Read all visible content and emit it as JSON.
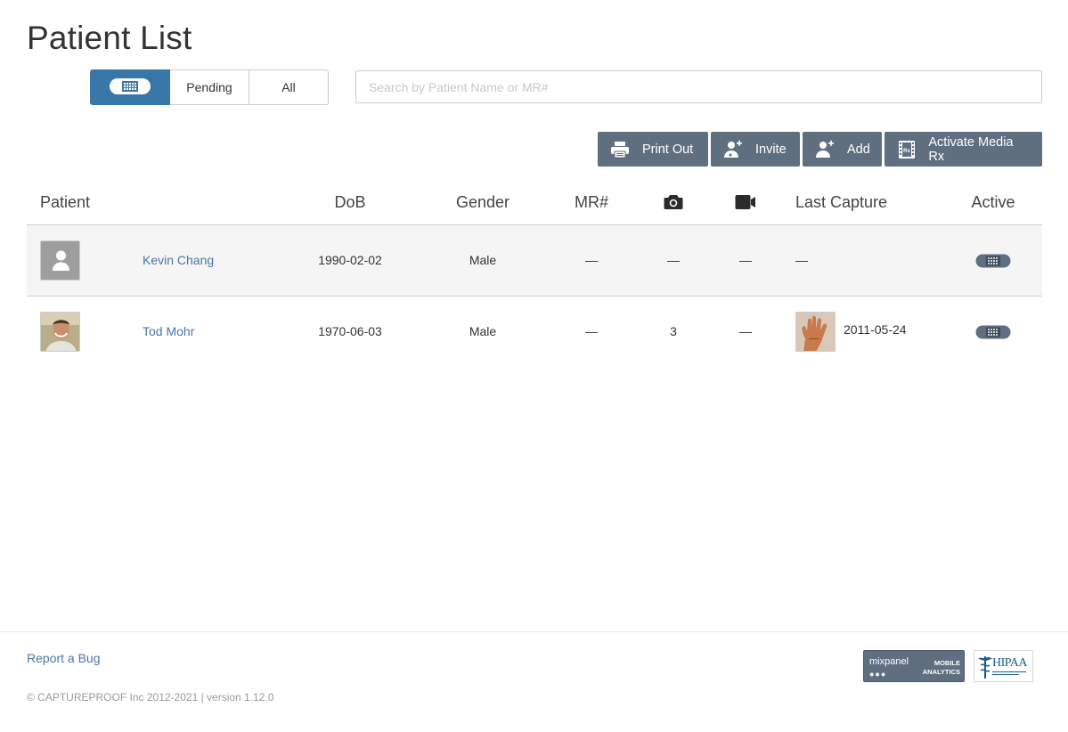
{
  "page": {
    "title": "Patient List"
  },
  "filters": {
    "active_icon": "toggle-on-icon",
    "pending_label": "Pending",
    "all_label": "All"
  },
  "search": {
    "placeholder": "Search by Patient Name or MR#"
  },
  "toolbar": {
    "print_label": "Print Out",
    "invite_label": "Invite",
    "add_label": "Add",
    "activate_label": "Activate Media Rx"
  },
  "table": {
    "headers": {
      "patient": "Patient",
      "dob": "DoB",
      "gender": "Gender",
      "mr": "MR#",
      "photos_icon": "camera-icon",
      "videos_icon": "video-camera-icon",
      "last_capture": "Last Capture",
      "active": "Active"
    },
    "rows": [
      {
        "name": "Kevin Chang",
        "dob": "1990-02-02",
        "gender": "Male",
        "mr": "—",
        "photos": "—",
        "videos": "—",
        "last_capture": "—",
        "active": true,
        "avatar": "default-avatar"
      },
      {
        "name": "Tod Mohr",
        "dob": "1970-06-03",
        "gender": "Male",
        "mr": "—",
        "photos": "3",
        "videos": "—",
        "last_capture": "2011-05-24",
        "active": true,
        "avatar": "photo-avatar"
      }
    ]
  },
  "footer": {
    "report_bug": "Report a Bug",
    "copyright": "© CAPTUREPROOF Inc 2012-2021 | version 1.12.0",
    "mixpanel_name": "mixpanel",
    "mixpanel_sub": "MOBILE ANALYTICS",
    "hipaa_label": "HIPAA"
  },
  "colors": {
    "primary": "#3a77a9",
    "toolbar": "#5f6f80",
    "link": "#4a76a8"
  }
}
